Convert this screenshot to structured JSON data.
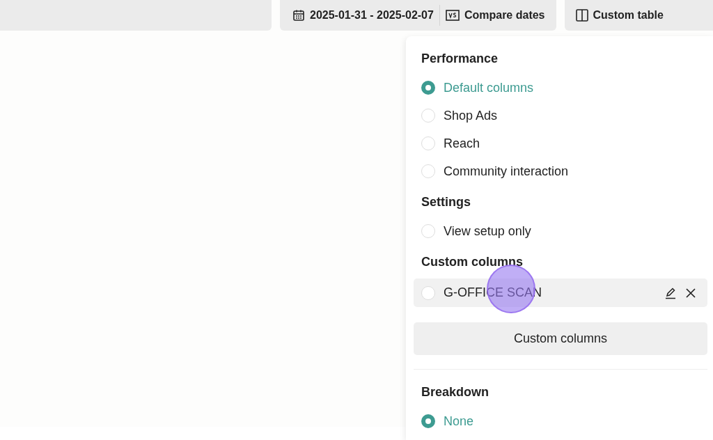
{
  "toolbar": {
    "date_range": "2025-01-31 - 2025-02-07",
    "compare": "Compare dates",
    "custom_table": "Custom table"
  },
  "panel": {
    "sections": [
      {
        "title": "Performance",
        "options": [
          {
            "label": "Default columns",
            "selected": true
          },
          {
            "label": "Shop Ads",
            "selected": false
          },
          {
            "label": "Reach",
            "selected": false
          },
          {
            "label": "Community interaction",
            "selected": false
          }
        ]
      },
      {
        "title": "Settings",
        "options": [
          {
            "label": "View setup only",
            "selected": false
          }
        ]
      }
    ],
    "custom_title": "Custom columns",
    "custom_items": [
      {
        "label": "G-OFFICE SCAN",
        "selected": false
      }
    ],
    "custom_button": "Custom columns",
    "breakdown_title": "Breakdown",
    "breakdown_options": [
      {
        "label": "None",
        "selected": true
      }
    ]
  }
}
